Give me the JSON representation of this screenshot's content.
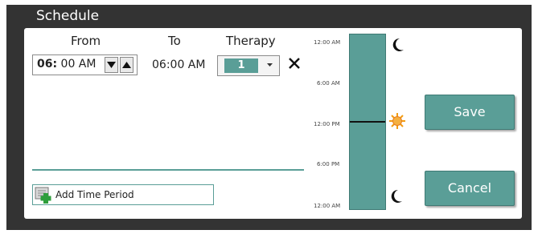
{
  "window": {
    "title": "Schedule"
  },
  "columns": {
    "from": "From",
    "to": "To",
    "therapy": "Therapy"
  },
  "row": {
    "from_hour": "06",
    "from_sep": ":",
    "from_rest": " 00  AM",
    "to": "06:00 AM",
    "therapy": "1"
  },
  "add_period_label": "Add Time Period",
  "timeline": {
    "labels": [
      "12:00 AM",
      "6:00 AM",
      "12:00 PM",
      "6:00 PM",
      "12:00 AM"
    ],
    "marker_fraction": 0.5
  },
  "buttons": {
    "save": "Save",
    "cancel": "Cancel"
  },
  "colors": {
    "accent": "#5a9e97",
    "frame": "#333333",
    "sun": "#f39c12"
  },
  "icons": [
    "moon-icon",
    "sun-icon",
    "chevron-down-icon",
    "chevron-up-icon",
    "close-icon",
    "add-time-period-icon"
  ]
}
